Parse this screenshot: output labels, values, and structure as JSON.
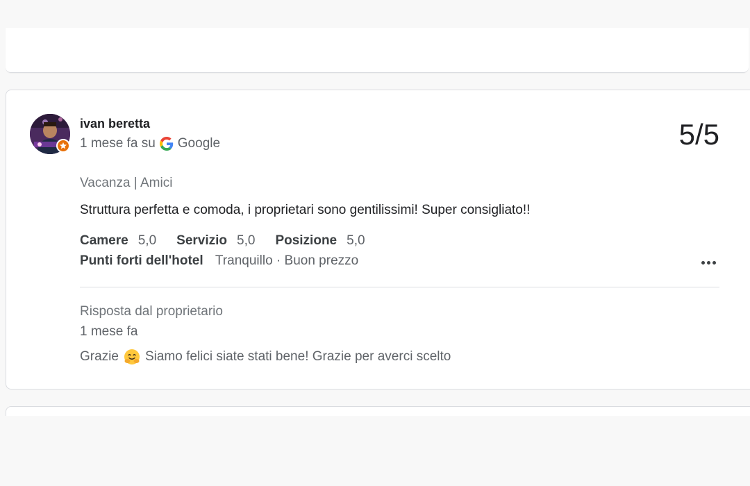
{
  "review": {
    "author": "ivan beretta",
    "time": "1 mese fa su",
    "source": "Google",
    "score": "5/5",
    "trip_type": "Vacanza | Amici",
    "text": "Struttura perfetta e comoda, i proprietari sono gentilissimi! Super consigliato!!",
    "ratings": [
      {
        "label": "Camere",
        "value": "5,0"
      },
      {
        "label": "Servizio",
        "value": "5,0"
      },
      {
        "label": "Posizione",
        "value": "5,0"
      }
    ],
    "highlights_label": "Punti forti dell'hotel",
    "highlights_value": "Tranquillo · Buon prezzo",
    "more_icon": "more-horiz-icon",
    "badge_icon": "local-guide-badge-icon"
  },
  "owner_reply": {
    "title": "Risposta dal proprietario",
    "date": "1 mese fa",
    "text_before": "Grazie",
    "emoji": "hugging-face-emoji",
    "text_after": "Siamo felici siate stati bene! Grazie per averci scelto"
  },
  "colors": {
    "google_blue": "#4285F4",
    "google_red": "#EA4335",
    "google_yellow": "#FBBC05",
    "google_green": "#34A853",
    "badge_orange": "#e8710a"
  }
}
